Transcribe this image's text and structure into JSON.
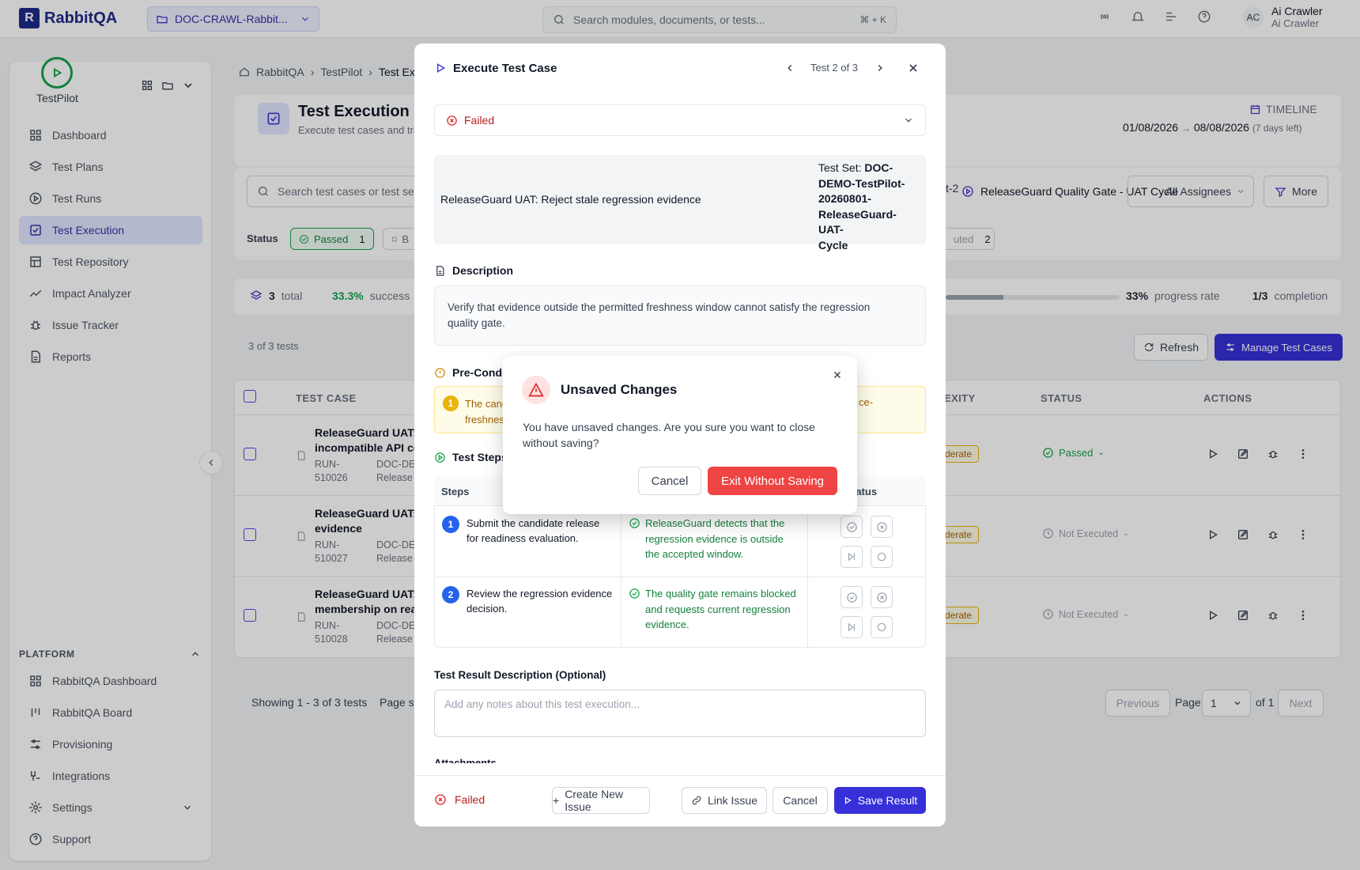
{
  "app": {
    "name": "RabbitQA",
    "project": "DOC-CRAWL-Rabbit...",
    "search_placeholder": "Search modules, documents, or tests...",
    "search_shortcut": "⌘ + K",
    "user_initials": "AC",
    "user_name": "Ai Crawler",
    "user_role": "Ai Crawler"
  },
  "sidebar": {
    "module": "TestPilot",
    "items": [
      {
        "label": "Dashboard"
      },
      {
        "label": "Test Plans"
      },
      {
        "label": "Test Runs"
      },
      {
        "label": "Test Execution",
        "active": true
      },
      {
        "label": "Test Repository"
      },
      {
        "label": "Impact Analyzer"
      },
      {
        "label": "Issue Tracker"
      },
      {
        "label": "Reports"
      }
    ],
    "platform_label": "PLATFORM",
    "platform_items": [
      {
        "label": "RabbitQA Dashboard"
      },
      {
        "label": "RabbitQA Board"
      },
      {
        "label": "Provisioning"
      },
      {
        "label": "Integrations"
      },
      {
        "label": "Settings"
      },
      {
        "label": "Support"
      }
    ]
  },
  "page": {
    "breadcrumb": [
      "RabbitQA",
      "TestPilot",
      "Test Ex"
    ],
    "title": "Test Execution",
    "subtitle": "Execute test cases and tra",
    "timeline_label": "TIMELINE",
    "timeline_start": "01/08/2026",
    "timeline_arrow": "→",
    "timeline_end": "08/08/2026",
    "timeline_days": "(7 days left)",
    "search_placeholder": "Search test cases or test se",
    "filter_cycle": "t-2",
    "filter_gate": "ReleaseGuard Quality Gate - UAT Cycle",
    "filter_assignees": "All Assignees",
    "more": "More",
    "status_label": "Status",
    "status_passed": "Passed",
    "status_passed_count": "1",
    "status_blocked_abbr": "B",
    "status_not_executed_frag": "uted",
    "status_not_executed_count": "2",
    "stats_total_num": "3",
    "stats_total_label": "total",
    "stats_success_num": "33.3%",
    "stats_success_label": "success",
    "stats_progress_num": "33%",
    "stats_progress_label": "progress rate",
    "stats_progress_fill": 0.33,
    "stats_completion_num": "1/3",
    "stats_completion_label": "completion",
    "count_text": "3 of 3 tests",
    "refresh": "Refresh",
    "manage": "Manage Test Cases",
    "col_case": "TEST CASE",
    "col_complexity": "EXITY",
    "col_status": "STATUS",
    "col_actions": "ACTIONS",
    "rows": [
      {
        "title1": "ReleaseGuard UAT: I",
        "title2": "incompatible API co",
        "run1": "RUN-",
        "run2": "510026",
        "doc1": "DOC-DE",
        "doc2": "Release",
        "complexity": "derate",
        "status": "Passed"
      },
      {
        "title1": "ReleaseGuard UAT: I",
        "title2": "evidence",
        "run1": "RUN-",
        "run2": "510027",
        "doc1": "DOC-DE",
        "doc2": "Release",
        "complexity": "derate",
        "status": "Not Executed"
      },
      {
        "title1": "ReleaseGuard UAT: I",
        "title2": "membership on reac",
        "run1": "RUN-",
        "run2": "510028",
        "doc1": "DOC-DE",
        "doc2": "Release",
        "complexity": "derate",
        "status": "Not Executed"
      }
    ],
    "footer_showing": "Showing 1 - 3 of 3 tests",
    "footer_pagesize": "Page si",
    "previous": "Previous",
    "page_label": "Page",
    "page_value": "1",
    "of_pages": "of 1",
    "next": "Next"
  },
  "modal": {
    "title": "Execute Test Case",
    "nav_text": "Test 2 of 3",
    "status_value": "Failed",
    "case_title": "ReleaseGuard UAT: Reject stale regression evidence",
    "testset_label": "Test Set:",
    "testset_lines": [
      "DOC-",
      "DEMO-TestPilot-",
      "20260801-",
      "ReleaseGuard-UAT-",
      "Cycle"
    ],
    "description_label": "Description",
    "description_line1": "Verify that evidence outside the permitted freshness window cannot satisfy the regression",
    "description_line2": "quality gate.",
    "precondition_label": "Pre-Condi",
    "precondition_num": "1",
    "precondition_frag1": "The canc",
    "precondition_frag2": "freshnes",
    "precondition_frag3": "ce-",
    "steps_label": "Test Steps",
    "steps_col": "Steps",
    "status_col": "tatus",
    "steps": [
      {
        "num": "1",
        "action1": "Submit the candidate release",
        "action2": "for readiness evaluation.",
        "expected1": "ReleaseGuard detects that the",
        "expected2": "regression evidence is outside",
        "expected3": "the accepted window."
      },
      {
        "num": "2",
        "action1": "Review the regression evidence",
        "action2": "decision.",
        "expected1": "The quality gate remains blocked",
        "expected2": "and requests current regression",
        "expected3": "evidence."
      }
    ],
    "result_label": "Test Result Description (Optional)",
    "result_placeholder": "Add any notes about this test execution...",
    "attachments_frag": "Attachments",
    "footer_status": "Failed",
    "create_issue": "Create New Issue",
    "link_issue": "Link Issue",
    "cancel": "Cancel",
    "save": "Save Result"
  },
  "dialog": {
    "title": "Unsaved Changes",
    "message_line1": "You have unsaved changes. Are you sure you want to close",
    "message_line2": "without saving?",
    "cancel": "Cancel",
    "confirm": "Exit Without Saving"
  },
  "colors": {
    "accent": "#3730d9",
    "danger": "#dc2626",
    "success": "#16a34a",
    "warning": "#ca8a04"
  }
}
